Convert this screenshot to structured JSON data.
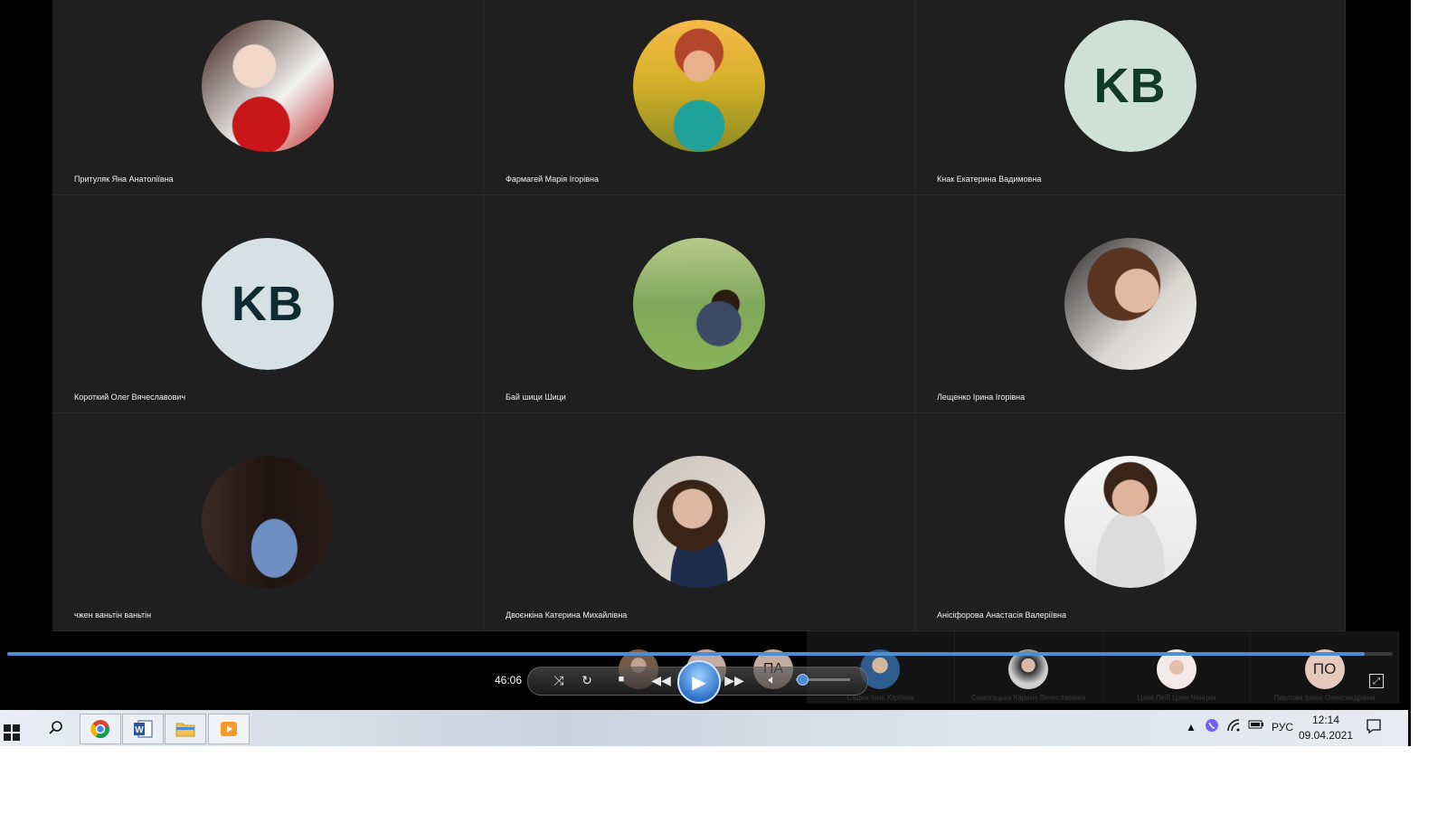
{
  "participants": [
    {
      "name": "Притуляк Яна Анатоліївна",
      "avatar_type": "photo"
    },
    {
      "name": "Фармагей Марія Ігорівна",
      "avatar_type": "photo"
    },
    {
      "name": "Кнак Екатерина Вадимовна",
      "avatar_type": "initials",
      "initials": "KB",
      "bg": "#cfe0d8",
      "fg": "#123a2a"
    },
    {
      "name": "Короткий Олег Вячеславович",
      "avatar_type": "initials",
      "initials": "KB",
      "bg": "#d6e1e6",
      "fg": "#102a33"
    },
    {
      "name": "Бай шици Шици",
      "avatar_type": "photo"
    },
    {
      "name": "Лещенко Ірина Ігорівна",
      "avatar_type": "photo"
    },
    {
      "name": "чжен ваньтін ваньтін",
      "avatar_type": "photo"
    },
    {
      "name": "Двоєнкіна Катерина Михайлівна",
      "avatar_type": "photo"
    },
    {
      "name": "Анісіфорова Анастасія Валеріївна",
      "avatar_type": "photo"
    }
  ],
  "strip": [
    {
      "name": "Сацюк Інна Юріївна",
      "avatar_type": "photo"
    },
    {
      "name": "Самогацька Карина Вячеславівна",
      "avatar_type": "photo"
    },
    {
      "name": "Цзен Лиій Цзен Ченцин",
      "avatar_type": "photo"
    },
    {
      "name": "Павлова Ірина Олександрівна",
      "avatar_type": "initials",
      "initials": "ПО"
    }
  ],
  "overlay_initials": [
    "ПА"
  ],
  "player": {
    "elapsed": "46:06",
    "progress_fraction": 0.98,
    "volume_fraction": 0.1,
    "icons": [
      "shuffle-icon",
      "repeat-icon",
      "stop-icon",
      "rewind-icon",
      "play-icon",
      "fast-forward-icon",
      "volume-icon",
      "fullscreen-icon"
    ]
  },
  "taskbar": {
    "apps": [
      "start-icon",
      "search-icon",
      "chrome-icon",
      "word-icon",
      "file-explorer-icon",
      "media-player-icon"
    ],
    "language": "РУС",
    "time": "12:14",
    "date": "09.04.2021"
  },
  "colors": {
    "accent": "#4a8fd6",
    "tile_bg": "#1f1f1f"
  }
}
